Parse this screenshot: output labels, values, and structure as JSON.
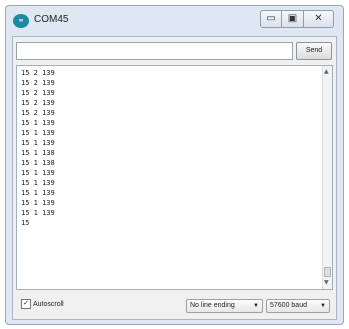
{
  "window": {
    "title": "COM45",
    "icon_label": "∞",
    "controls": {
      "minimize": "▭",
      "maximize": "▣",
      "close": "✕"
    }
  },
  "send": {
    "input_value": "",
    "button_label": "Send"
  },
  "output": {
    "lines": [
      "15 2 139",
      "15 2 139",
      "15 2 139",
      "15 2 139",
      "15 2 139",
      "15 1 139",
      "15 1 139",
      "15 1 139",
      "15 1 138",
      "15 1 138",
      "15 1 139",
      "15 1 139",
      "15 1 139",
      "15 1 139",
      "15 1 139",
      "15"
    ]
  },
  "statusbar": {
    "autoscroll_checked": "✓",
    "autoscroll_label": "Autoscroll",
    "line_ending": "No line ending",
    "baud": "57600 baud"
  },
  "icons": [
    "arduino-icon",
    "minimize-icon",
    "maximize-icon",
    "close-icon",
    "checkbox-icon",
    "chevron-down-icon"
  ]
}
